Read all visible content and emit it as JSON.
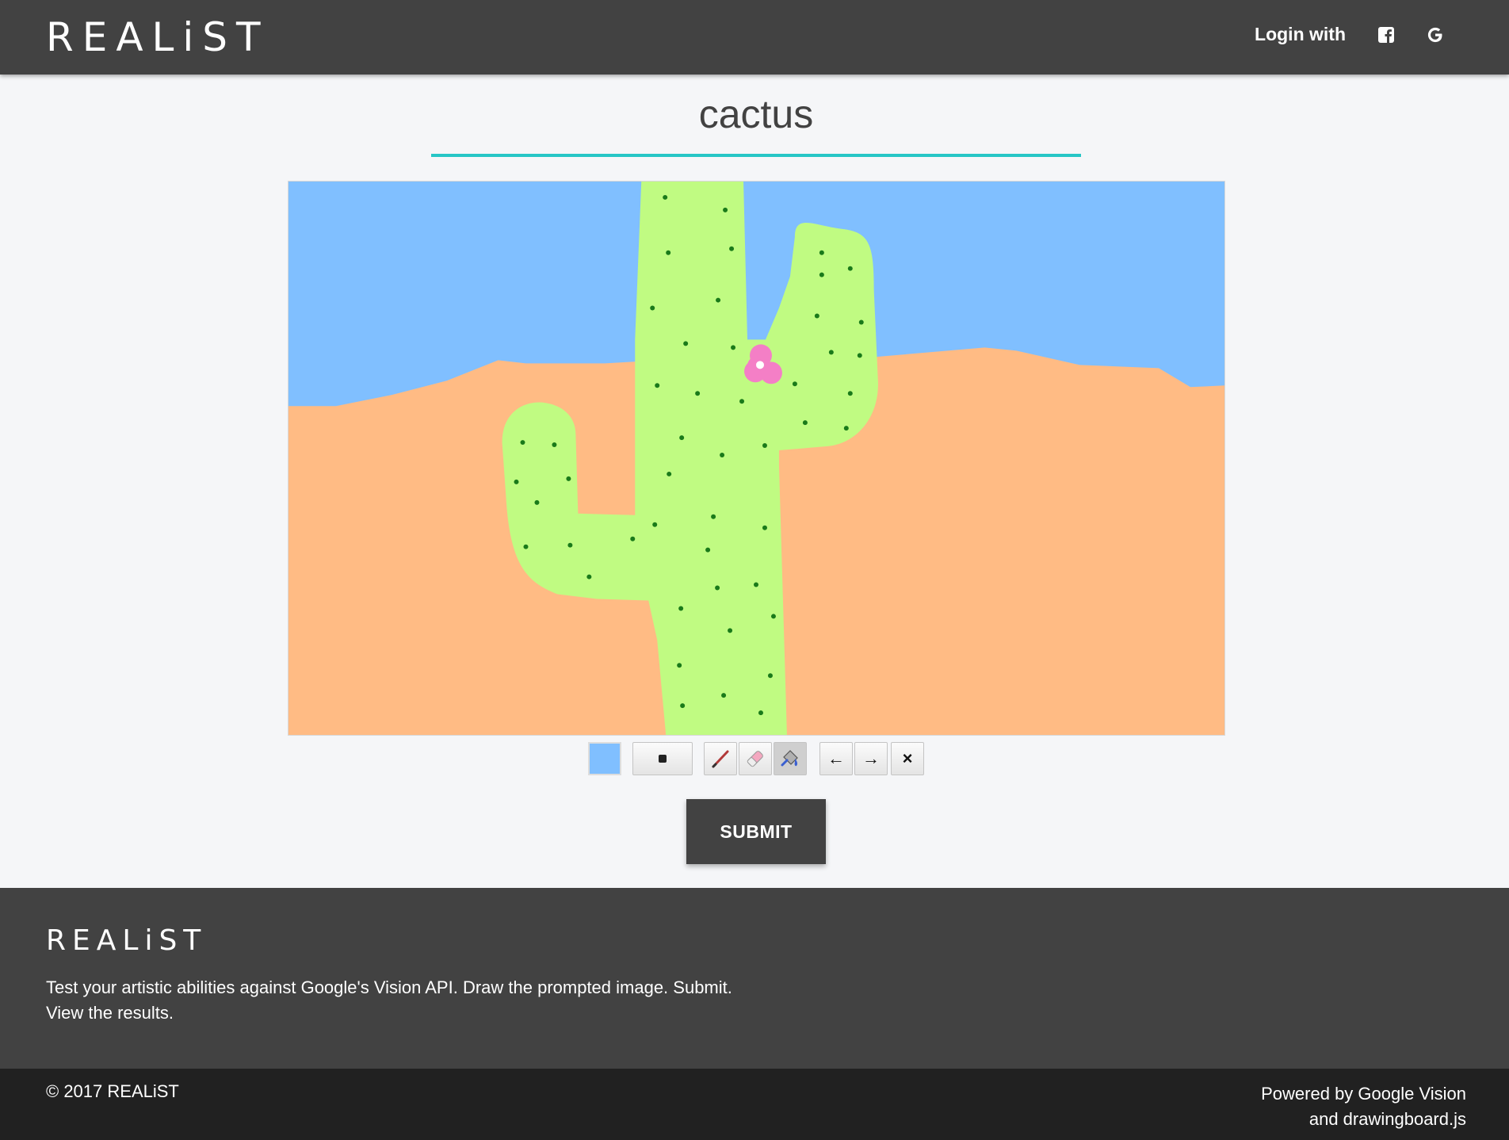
{
  "header": {
    "brand": "REALiST",
    "login_label": "Login with",
    "icons": [
      "facebook-icon",
      "google-icon"
    ]
  },
  "prompt": {
    "word": "cactus",
    "underline_color": "#26c6c6"
  },
  "drawing": {
    "colors": {
      "sky": "#80bfff",
      "sand": "#ffbb84",
      "cactus": "#c0fb82",
      "spines": "#1a7a1a",
      "flower": "#f47fc6"
    }
  },
  "toolbar": {
    "current_color": "#80bfff",
    "tools": [
      "pencil-tool",
      "eraser-tool",
      "fill-tool"
    ],
    "active_tool": "fill-tool",
    "undo_glyph": "←",
    "redo_glyph": "→",
    "clear_glyph": "×"
  },
  "submit_label": "SUBMIT",
  "footer": {
    "brand": "REALiST",
    "description_line1": "Test your artistic abilities against Google's Vision API. Draw the prompted image. Submit.",
    "description_line2": "View the results.",
    "copyright": "© 2017 REALiST",
    "powered_line1": "Powered by Google Vision",
    "powered_line2": "and drawingboard.js"
  }
}
